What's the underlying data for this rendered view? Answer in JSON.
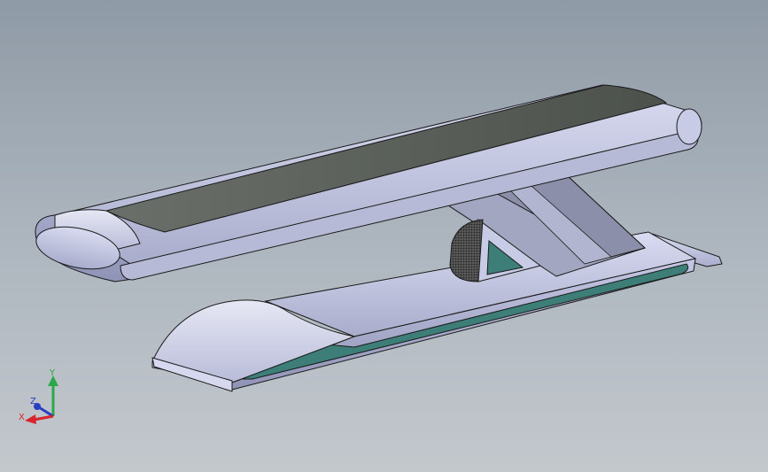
{
  "viewport": {
    "background_top": "#8e9aa6",
    "background_bottom": "#c3c8cd"
  },
  "model": {
    "body_color": "#c9cce6",
    "edge_color": "#1a1a1a",
    "top_surface_color": "#5b605b",
    "inset_color": "#3d7f78",
    "knurl_color": "#333333"
  },
  "triad": {
    "labels": {
      "x": "X",
      "y": "Y",
      "z": "Z"
    },
    "colors": {
      "x": "#d9232e",
      "y": "#2aa84a",
      "z": "#2a3fc0"
    }
  }
}
